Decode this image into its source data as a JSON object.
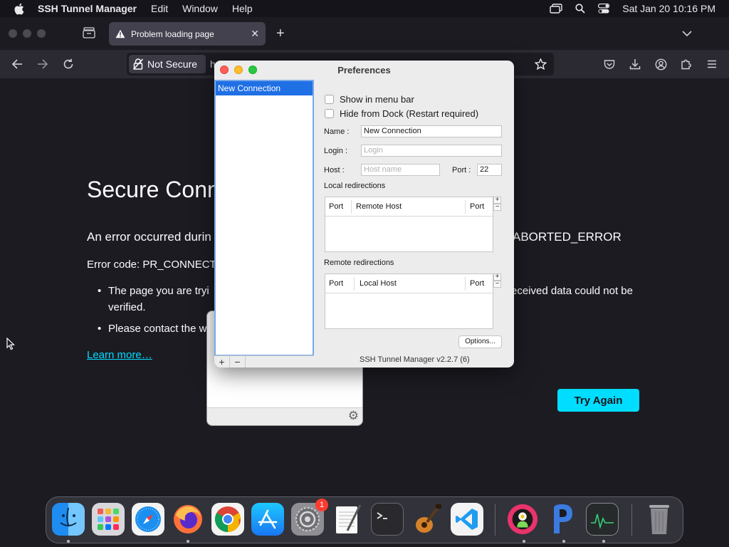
{
  "menubar": {
    "app_name": "SSH Tunnel Manager",
    "items": [
      "Edit",
      "Window",
      "Help"
    ],
    "clock": "Sat Jan 20  10:16 PM"
  },
  "browser": {
    "tab_title": "Problem loading page",
    "security_label": "Not Secure",
    "url_partial": "h"
  },
  "error_page": {
    "title_partial": "Secure Conn",
    "description_partial": "An error occurred durin",
    "description_right_partial": "ABORTED_ERROR",
    "error_code_partial": "Error code: PR_CONNECT",
    "bullet1_line1_left": "The page you are tryi",
    "bullet1_line1_right": "eceived data could not be",
    "bullet1_line2": "verified.",
    "bullet2_partial": "Please contact the w",
    "learn_more": "Learn more…",
    "try_again": "Try Again"
  },
  "prefs": {
    "title": "Preferences",
    "connections": [
      "New Connection"
    ],
    "show_in_menu_bar": "Show in menu bar",
    "hide_from_dock": "Hide from Dock (Restart required)",
    "name_label": "Name :",
    "name_value": "New Connection",
    "login_label": "Login :",
    "login_placeholder": "Login",
    "host_label": "Host :",
    "host_placeholder": "Host name",
    "port_label": "Port :",
    "port_value": "22",
    "local_redirections": "Local redirections",
    "local_headers": [
      "Port",
      "Remote Host",
      "Port"
    ],
    "remote_redirections": "Remote redirections",
    "remote_headers": [
      "Port",
      "Local Host",
      "Port"
    ],
    "options_button": "Options...",
    "version": "SSH Tunnel Manager v2.2.7 (6)"
  },
  "dock": {
    "apps": [
      "Finder",
      "Launchpad",
      "Safari",
      "Firefox",
      "Chrome",
      "App Store",
      "System Settings",
      "TextEdit",
      "Terminal",
      "GarageBand",
      "VS Code",
      "SSH Tunnel Manager",
      "PyCharm",
      "Activity Monitor",
      "Trash"
    ],
    "settings_badge": "1"
  }
}
